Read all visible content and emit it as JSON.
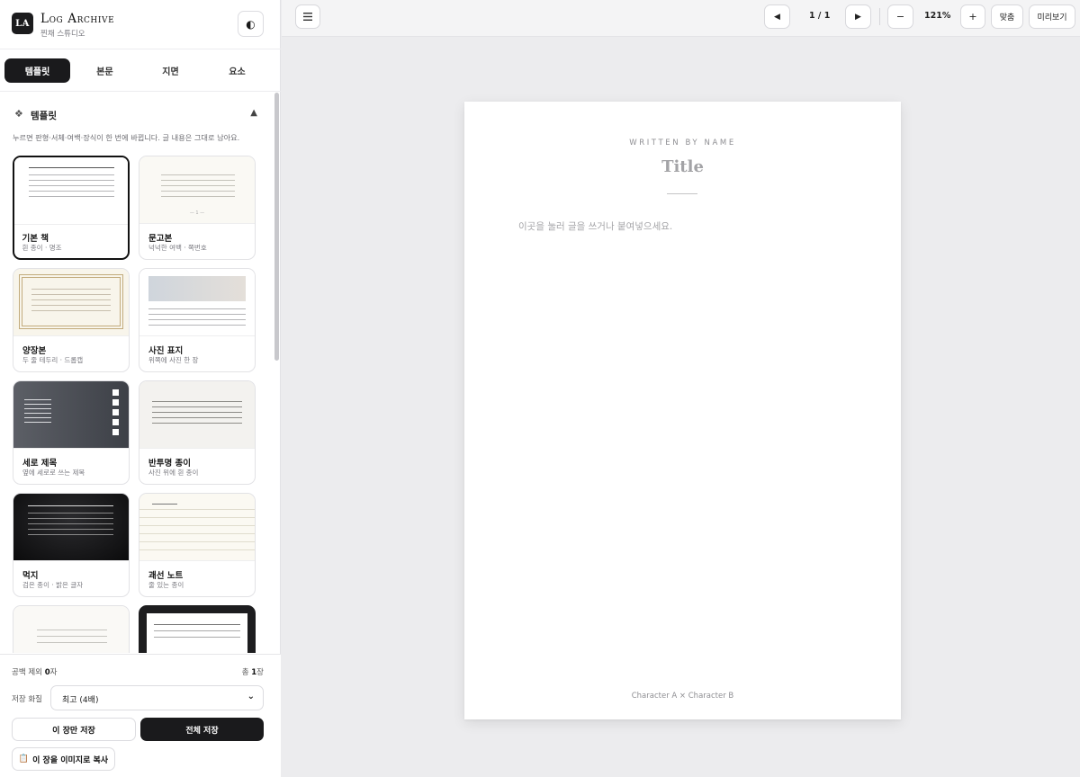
{
  "brand": {
    "logo": "LA",
    "title": "Log Archive",
    "subtitle": "찐채 스튜디오"
  },
  "theme_toggle": {
    "icon": "contrast-icon",
    "glyph": "◐"
  },
  "tabs": [
    {
      "label": "템플릿",
      "active": true
    },
    {
      "label": "본문",
      "active": false
    },
    {
      "label": "지면",
      "active": false
    },
    {
      "label": "요소",
      "active": false
    }
  ],
  "templates_section": {
    "icon": "diamond-icon",
    "icon_glyph": "❖",
    "title": "템플릿",
    "collapse_glyph": "▲",
    "description": "누르면 판형·서체·여백·장식이 한 번에 바뀝니다. 글 내용은 그대로 남아요.",
    "items": [
      {
        "name": "기본 책",
        "desc": "흰 종이 · 명조",
        "selected": true
      },
      {
        "name": "문고본",
        "desc": "넉넉한 여백 · 쪽번호",
        "selected": false
      },
      {
        "name": "양장본",
        "desc": "두 줄 테두리 · 드롭캡",
        "selected": false
      },
      {
        "name": "사진 표지",
        "desc": "위쪽에 사진 한 장",
        "selected": false
      },
      {
        "name": "세로 제목",
        "desc": "옆에 세로로 쓰는 제목",
        "selected": false
      },
      {
        "name": "반투명 종이",
        "desc": "사진 위에 흰 종이",
        "selected": false
      },
      {
        "name": "먹지",
        "desc": "검은 종이 · 밝은 글자",
        "selected": false
      },
      {
        "name": "괘선 노트",
        "desc": "줄 있는 종이",
        "selected": false
      },
      {
        "name": "",
        "desc": "",
        "selected": false
      },
      {
        "name": "",
        "desc": "",
        "selected": false
      }
    ]
  },
  "footer": {
    "chars_label": "공백 제외",
    "chars_value": "0",
    "chars_unit": "자",
    "pages_label": "총",
    "pages_value": "1",
    "pages_unit": "장",
    "quality_label": "저장 화질",
    "quality_value": "최고 (4배)",
    "save_page_label": "이 장만 저장",
    "save_all_label": "전체 저장",
    "copy_image_label": "이 장을 이미지로 복사",
    "copy_icon": "clipboard-icon"
  },
  "toolbar": {
    "menu_icon": "menu-icon",
    "prev_icon": "prev-page-icon",
    "next_icon": "next-page-icon",
    "page_indicator": "1 / 1",
    "zoom_out": "−",
    "zoom_level": "121%",
    "zoom_in": "+",
    "fit_label": "맞춤",
    "preview_label": "미리보기"
  },
  "page": {
    "author": "WRITTEN BY NAME",
    "title": "Title",
    "body_placeholder": "이곳을 눌러 글을 쓰거나 붙여넣으세요.",
    "footer": "Character A × Character B"
  },
  "colors": {
    "accent_dark": "#1a1a1c",
    "canvas_bg": "#ececee",
    "page_bg": "#ffffff"
  }
}
